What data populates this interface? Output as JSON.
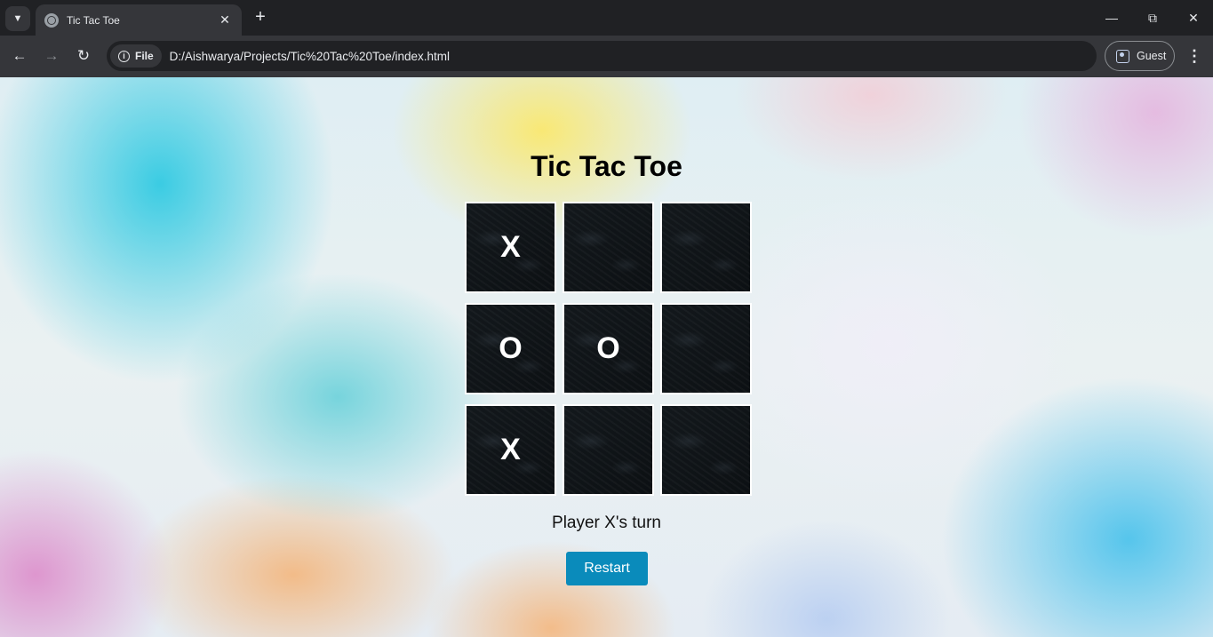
{
  "browser": {
    "tab_title": "Tic Tac Toe",
    "site_info_label": "File",
    "url": "D:/Aishwarya/Projects/Tic%20Tac%20Toe/index.html",
    "profile_label": "Guest",
    "icons": {
      "tab_search": "chevron-down-icon",
      "tab_close": "close-icon",
      "new_tab": "plus-icon",
      "back": "arrow-left-icon",
      "forward": "arrow-right-icon",
      "reload": "reload-icon",
      "site_info": "info-icon",
      "profile": "profile-icon",
      "menu": "kebab-menu-icon",
      "minimize": "minimize-icon",
      "restore": "restore-icon",
      "close_window": "close-icon"
    }
  },
  "game": {
    "title": "Tic Tac Toe",
    "cells": [
      "X",
      "",
      "",
      "O",
      "O",
      "",
      "X",
      "",
      ""
    ],
    "status": "Player X's turn",
    "restart_label": "Restart",
    "colors": {
      "cell_background": "#101417",
      "cell_border": "#ffffff",
      "mark": "#ffffff",
      "restart_button": "#0a8bbb"
    }
  }
}
